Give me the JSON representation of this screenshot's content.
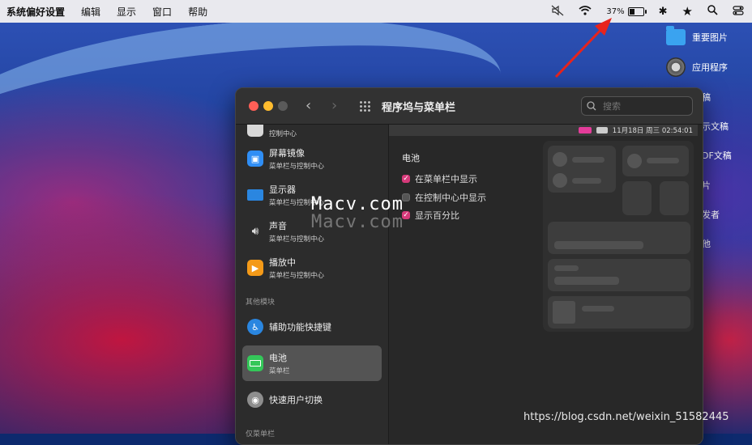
{
  "menubar": {
    "app_name": "系统偏好设置",
    "items": [
      "编辑",
      "显示",
      "窗口",
      "帮助"
    ],
    "battery_percent": "37%",
    "battery_level": 0.37
  },
  "desktop": {
    "icons": [
      "重要图片",
      "应用程序"
    ],
    "fragments": [
      "稿",
      "示文稿",
      "DF文稿",
      "片",
      "发者",
      "他"
    ]
  },
  "window": {
    "title": "程序坞与菜单栏",
    "search_placeholder": "搜索"
  },
  "sidebar": {
    "partial_item_sub": "控制中心",
    "items": [
      {
        "title": "屏幕镜像",
        "sub": "菜单栏与控制中心",
        "color": "#2f8ef5",
        "icon": "screen-mirroring-icon"
      },
      {
        "title": "显示器",
        "sub": "菜单栏与控制中心",
        "color": "#2a86e0",
        "icon": "display-icon"
      },
      {
        "title": "声音",
        "sub": "菜单栏与控制中心",
        "color": "#6e6e6e",
        "icon": "sound-icon"
      },
      {
        "title": "播放中",
        "sub": "菜单栏与控制中心",
        "color": "#f49a18",
        "icon": "now-playing-icon"
      }
    ],
    "section_other": "其他模块",
    "other_items": [
      {
        "title": "辅助功能快捷键",
        "sub": "",
        "color": "#2a86e0",
        "icon": "accessibility-icon"
      },
      {
        "title": "电池",
        "sub": "菜单栏",
        "color": "#34c759",
        "icon": "battery-icon",
        "selected": true
      },
      {
        "title": "快速用户切换",
        "sub": "",
        "color": "#8e8e8e",
        "icon": "user-switch-icon"
      }
    ],
    "section_menubar_only": "仅菜单栏"
  },
  "preview_bar": {
    "datetime": "11月18日 周三  02:54:01"
  },
  "battery_pane": {
    "title": "电池",
    "options": [
      {
        "label": "在菜单栏中显示",
        "checked": true
      },
      {
        "label": "在控制中心中显示",
        "checked": false
      },
      {
        "label": "显示百分比",
        "checked": true
      }
    ]
  },
  "overlays": {
    "watermark": "Macv.com",
    "csdn": "https://blog.csdn.net/weixin_51582445"
  }
}
